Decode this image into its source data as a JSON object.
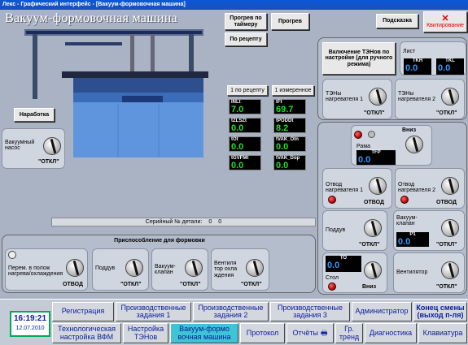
{
  "window_title": "Лекс - Графический интерфейс - [Вакуум-формовочная машина]",
  "app_title": "Вакуум-формовочная машина",
  "top_buttons": {
    "timer_preheat": "Прогрев по таймеру",
    "preheat": "Прогрев",
    "by_recipe": "По рецепту",
    "hint": "Подсказка",
    "ack": "Квитирование"
  },
  "tabs": {
    "by_recipe": "1 по рецепту",
    "measured": "1 измеренное"
  },
  "work_time": "Наработка",
  "sensors": [
    {
      "cap": "INLt",
      "val": "7.0"
    },
    {
      "cap": "tFt",
      "val": "69.7"
    },
    {
      "cap": "tZLSZt",
      "val": "0.0"
    },
    {
      "cap": "tPODDt",
      "val": "8.2"
    },
    {
      "cap": "tOt",
      "val": "0.0"
    },
    {
      "cap": "tVAK_Otn",
      "val": "0.0"
    },
    {
      "cap": "tGVFMt",
      "val": "0.0"
    },
    {
      "cap": "tVAK_Dop",
      "val": "0.0"
    }
  ],
  "vacuum_pump": {
    "label": "Вакуумный насос",
    "state": "\"ОТКЛ\""
  },
  "serial": {
    "label": "Серийный № детали:",
    "a": "0",
    "b": "0"
  },
  "fixture": {
    "title": "Приспособление для формовки",
    "move": "Перем. в полож нагрева/охлаждения",
    "move_state": "ОТВОД",
    "blow": "Поддув",
    "blow_state": "\"ОТКЛ\"",
    "valve": "Вакуум- клапан",
    "valve_state": "\"ОТКЛ\"",
    "cool": "Вентиля тор охла ждения",
    "cool_state": "\"ОТКЛ\""
  },
  "heaters": {
    "manual_btn": "Включение ТЭНов по настройке (для ручного режима)",
    "sheet": "Лист",
    "tkh": {
      "cap": "TKH",
      "val": "0.0"
    },
    "tkl": {
      "cap": "TKL",
      "val": "0.0"
    },
    "h1": "ТЭНы нагревателя 1",
    "h1_state": "\"ОТКЛ\"",
    "h2": "ТЭНы нагревателя 2",
    "h2_state": "\"ОТКЛ\""
  },
  "frame": {
    "down": "Вниз",
    "label": "Рама",
    "tfp": {
      "cap": "TFP",
      "val": "0.0"
    },
    "retract1": "Отвод нагревателя 1",
    "retract1_state": "ОТВОД",
    "retract2": "Отвод нагревателя 2",
    "retract2_state": "ОТВОД",
    "blow": "Поддув",
    "blow_state": "\"ОТКЛ\"",
    "vac_valve": "Вакуум- клапан",
    "vac_valve_state": "\"ОТКЛ\"",
    "p1": {
      "cap": "P1",
      "val": "0.0"
    },
    "to": {
      "cap": "TO",
      "val": "0.0"
    },
    "table": "Стол",
    "table_state": "Вниз",
    "fan": "Вентилятор",
    "fan_state": "\"ОТКЛ\""
  },
  "clock": {
    "time": "16:19:21",
    "date": "12.07.2010"
  },
  "nav": [
    {
      "label": "Регистрация"
    },
    {
      "label": "Производственные задания 1"
    },
    {
      "label": "Производственные задания 2"
    },
    {
      "label": "Производственные задания 3"
    },
    {
      "label": "Администратор"
    },
    {
      "label": "Конец смены (выход п-ля)"
    },
    {
      "label": "Технологическая настройка ВФМ"
    },
    {
      "label": "Настройка ТЭНов"
    },
    {
      "label": "Вакуум-формо вочная машина"
    },
    {
      "label": "Протокол"
    },
    {
      "label": "Отчёты"
    },
    {
      "label": "Гр. тренд"
    },
    {
      "label": "Диагностика"
    },
    {
      "label": "Клавиатура"
    }
  ],
  "colors": {
    "active_tab": "#3fc4d6",
    "value_green": "#22e022",
    "value_blue": "#3399ff",
    "title_bar": "#0a58d8"
  }
}
